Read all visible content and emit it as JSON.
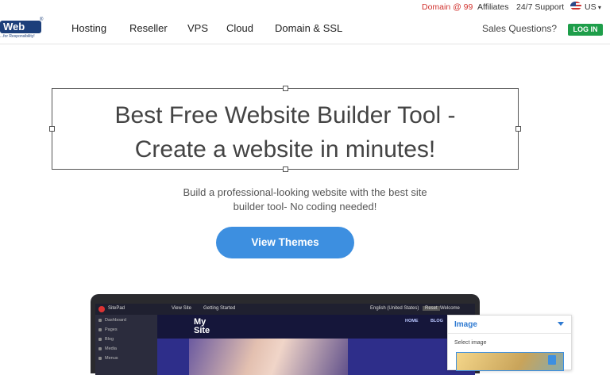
{
  "topbar": {
    "promo": "Domain @ 99",
    "affiliates": "Affiliates",
    "support": "24/7 Support",
    "language": "US"
  },
  "logo": {
    "text": "Web",
    "tagline": "...for Responsibility!",
    "reg": "®"
  },
  "nav": {
    "items": [
      "Hosting",
      "Reseller",
      "VPS",
      "Cloud",
      "Domain & SSL"
    ],
    "sales": "Sales Questions?",
    "login": "LOG IN"
  },
  "hero": {
    "title_line1": "Best Free Website Builder Tool -",
    "title_line2": "Create a website in minutes!",
    "subtitle_line1": "Build a professional-looking website with the best site",
    "subtitle_line2": "builder tool- No coding needed!",
    "cta": "View Themes"
  },
  "preview": {
    "app_name": "SitePad",
    "top_links": [
      "View Site",
      "Getting Started",
      "English (United States)",
      "Reset",
      "Welcome"
    ],
    "sidebar": [
      "Dashboard",
      "Pages",
      "Blog",
      "Media",
      "Menus"
    ],
    "site_title_line1": "My",
    "site_title_line2": "Site",
    "site_links": [
      "HOME",
      "BLOG"
    ],
    "panel_title": "Image",
    "panel_label": "Select image"
  },
  "colors": {
    "accent": "#3d8fe0",
    "promo": "#d0312d",
    "login": "#1e9e4a"
  }
}
